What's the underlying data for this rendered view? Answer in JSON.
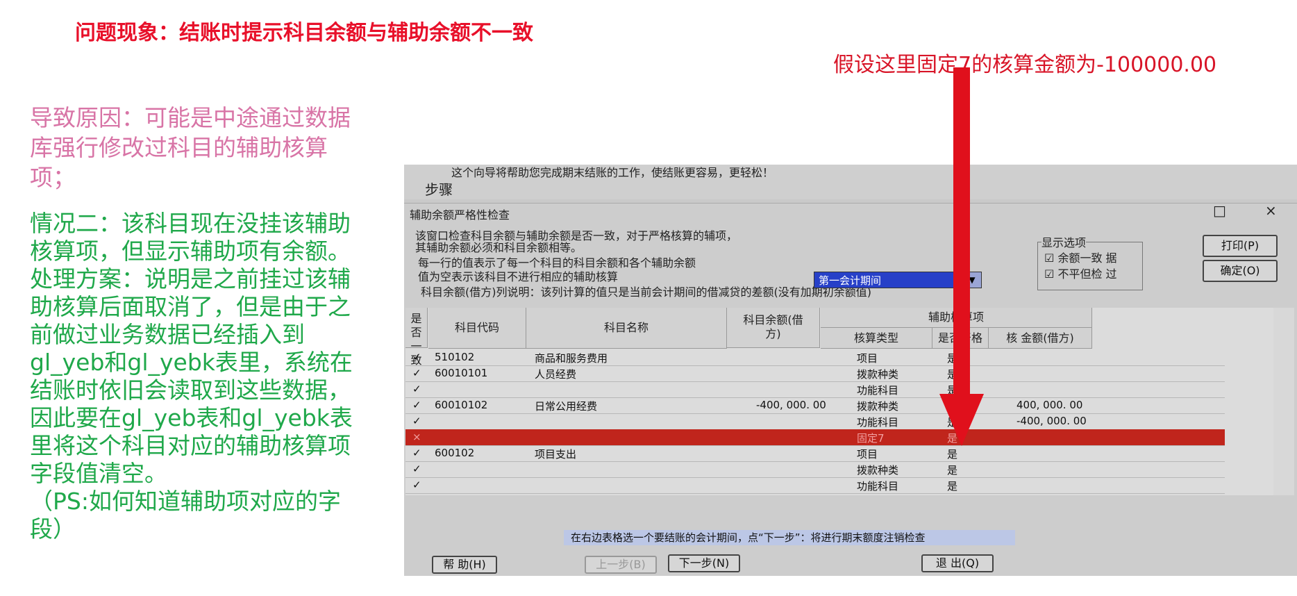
{
  "slide": {
    "title": "问题现象：结账时提示科目余额与辅助余额不一致",
    "assume_note": "假设这里固定7的核算金额为-100000.00",
    "cause": "导致原因：可能是中途通过数据库强行修改过科目的辅助核算项；",
    "case2": "情况二：该科目现在没挂该辅助核算项，但显示辅助项有余额。",
    "solution": "处理方案：说明是之前挂过该辅助核算后面取消了，但是由于之前做过业务数据已经插入到gl_yeb和gl_yebk表里，系统在结账时依旧会读取到这些数据，因此要在gl_yeb表和gl_yebk表里将这个科目对应的辅助核算项字段值清空。",
    "ps": "（PS:如何知道辅助项对应的字段）"
  },
  "colors": {
    "title_red": "#e8102a",
    "cause_pink": "#d874a6",
    "solution_green": "#1fa84a",
    "highlight_row": "#c0251c",
    "arrow_red": "#e0101c"
  },
  "wizard": {
    "intro": "这个向导将帮助您完成期末结账的工作，使结账更容易，更轻松！",
    "steps_label": "步骤",
    "status": "在右边表格选一个要结账的会计期间，点“下一步”：将进行期末额度注销检查",
    "help_button": "帮  助(H)",
    "prev_button": "上一步(B)",
    "next_button": "下一步(N)",
    "exit_button": "退  出(Q)"
  },
  "dialog": {
    "title": "辅助余额严格性检查",
    "desc1": "该窗口检查科目余额与辅助余额是否一致，对于严格核算的辅项，",
    "desc2": "其辅助余额必须和科目余额相等。",
    "desc3": "每一行的值表示了每一个科目的科目余额和各个辅助余额",
    "desc4": "值为空表示该科目不进行相应的辅助核算",
    "note": "科目余额(借方)列说明：该列计算的值只是当前会计期间的借减贷的差额(没有加期初余额值)",
    "period_value": "第一会计期间",
    "options_title": "显示选项",
    "opt1": "余额一致  据",
    "opt2": "不平但检  过",
    "print_button": "打印(P)",
    "ok_button": "确定(O)",
    "max_icon": "□",
    "close_icon": "×"
  },
  "table": {
    "headers": {
      "consistent": "是否一致",
      "code": "科目代码",
      "name": "科目名称",
      "balance": "科目余额(借方)",
      "aux": "辅助核算项",
      "type": "核算类型",
      "strict": "是否严格",
      "amount": "核  金额(借方)"
    },
    "rows": [
      {
        "flag": "✓",
        "code": "510102",
        "name": "商品和服务费用",
        "balance": "",
        "type": "项目",
        "strict": "是",
        "amount": ""
      },
      {
        "flag": "✓",
        "code": "60010101",
        "name": "人员经费",
        "balance": "",
        "type": "拨款种类",
        "strict": "是",
        "amount": ""
      },
      {
        "flag": "✓",
        "code": "",
        "name": "",
        "balance": "",
        "type": "功能科目",
        "strict": "是",
        "amount": ""
      },
      {
        "flag": "✓",
        "code": "60010102",
        "name": "日常公用经费",
        "balance": "-400, 000. 00",
        "type": "拨款种类",
        "strict": "是",
        "amount": "400, 000. 00"
      },
      {
        "flag": "✓",
        "code": "",
        "name": "",
        "balance": "",
        "type": "功能科目",
        "strict": "是",
        "amount": "-400, 000. 00"
      },
      {
        "flag": "×",
        "code": "",
        "name": "",
        "balance": "",
        "type": "固定7",
        "strict": "是",
        "amount": ""
      },
      {
        "flag": "✓",
        "code": "600102",
        "name": "项目支出",
        "balance": "",
        "type": "项目",
        "strict": "是",
        "amount": ""
      },
      {
        "flag": "✓",
        "code": "",
        "name": "",
        "balance": "",
        "type": "拨款种类",
        "strict": "是",
        "amount": ""
      },
      {
        "flag": "✓",
        "code": "",
        "name": "",
        "balance": "",
        "type": "功能科目",
        "strict": "是",
        "amount": ""
      }
    ]
  }
}
